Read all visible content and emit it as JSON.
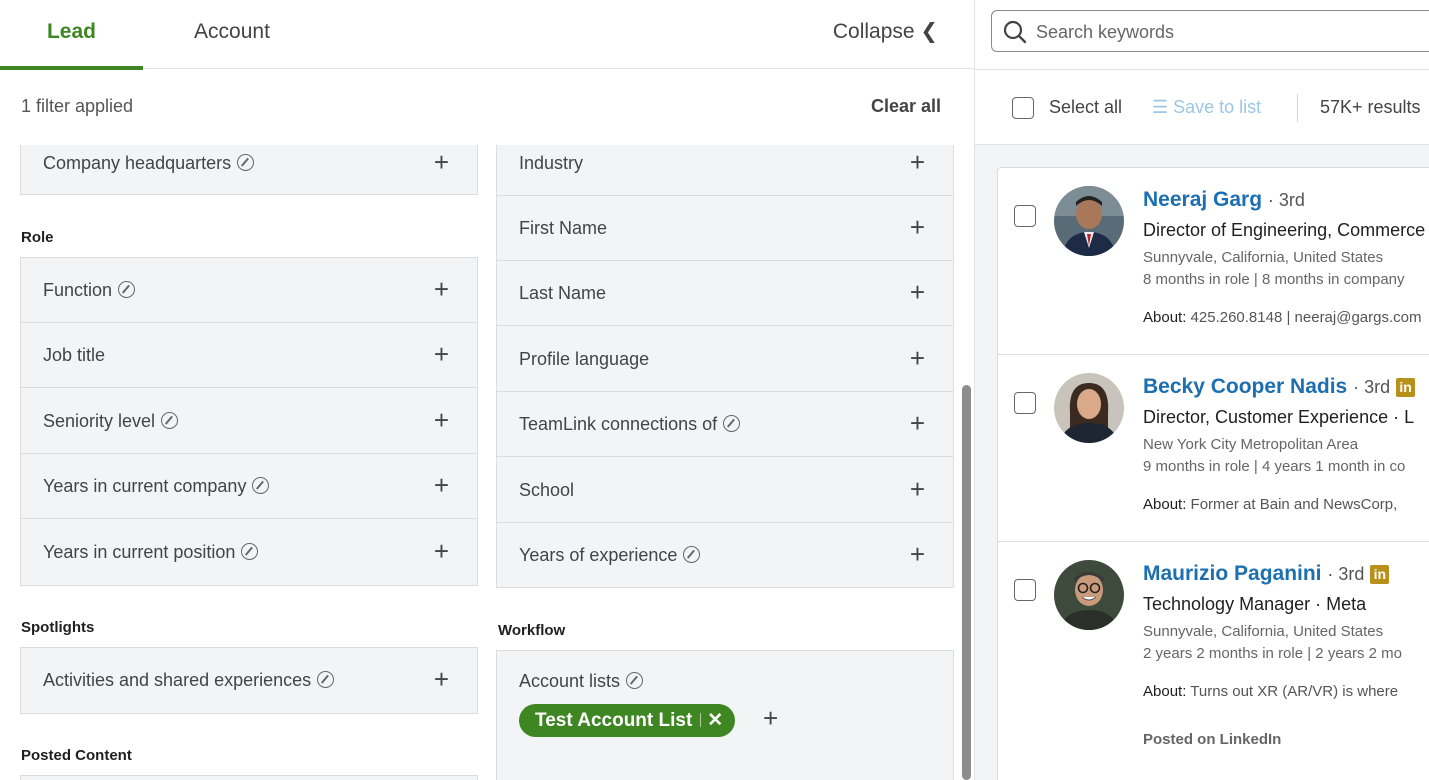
{
  "tabs": {
    "lead": "Lead",
    "account": "Account",
    "collapse": "Collapse ❮"
  },
  "filters": {
    "applied": "1 filter applied",
    "clear_all": "Clear all",
    "left_col": {
      "company_hq": "Company headquarters",
      "role_heading": "Role",
      "role_items": [
        "Function",
        "Job title",
        "Seniority level",
        "Years in current company",
        "Years in current position"
      ],
      "spotlights_heading": "Spotlights",
      "spotlights_item": "Activities and shared experiences",
      "posted_heading": "Posted Content"
    },
    "right_col": {
      "items": [
        "Industry",
        "First Name",
        "Last Name",
        "Profile language",
        "TeamLink connections of",
        "School",
        "Years of experience"
      ],
      "workflow_heading": "Workflow",
      "account_lists": "Account lists",
      "chip_label": "Test Account List",
      "chip_remove": "✕"
    },
    "plus": "+"
  },
  "search": {
    "placeholder": "Search keywords"
  },
  "results_bar": {
    "select_all": "Select all",
    "save_to_list": "☰ Save to list",
    "count": "57K+ results"
  },
  "results": [
    {
      "name": "Neeraj Garg",
      "degree": "· 3rd",
      "title": "Director of Engineering, Commerce",
      "location": "Sunnyvale, California, United States",
      "tenure": "8 months in role | 8 months in company",
      "about_label": "About:",
      "about": "425.260.8148 | neeraj@gargs.com"
    },
    {
      "name": "Becky Cooper Nadis",
      "degree": "· 3rd",
      "title": "Director, Customer Experience · L",
      "location": "New York City Metropolitan Area",
      "tenure": "9 months in role | 4 years 1 month in co",
      "about_label": "About:",
      "about": "Former at Bain and NewsCorp,",
      "badge": "in"
    },
    {
      "name": "Maurizio Paganini",
      "degree": "· 3rd",
      "title": "Technology Manager · Meta",
      "location": "Sunnyvale, California, United States",
      "tenure": "2 years 2 months in role | 2 years 2 mo",
      "about_label": "About:",
      "about": "Turns out XR (AR/VR) is where",
      "posted": "Posted on LinkedIn",
      "badge": "in"
    }
  ],
  "colors": {
    "accent_green": "#3d8622",
    "link_blue": "#1d6fb0",
    "panel_bg": "#f3f4f6",
    "badge_gold": "#b8901c"
  }
}
